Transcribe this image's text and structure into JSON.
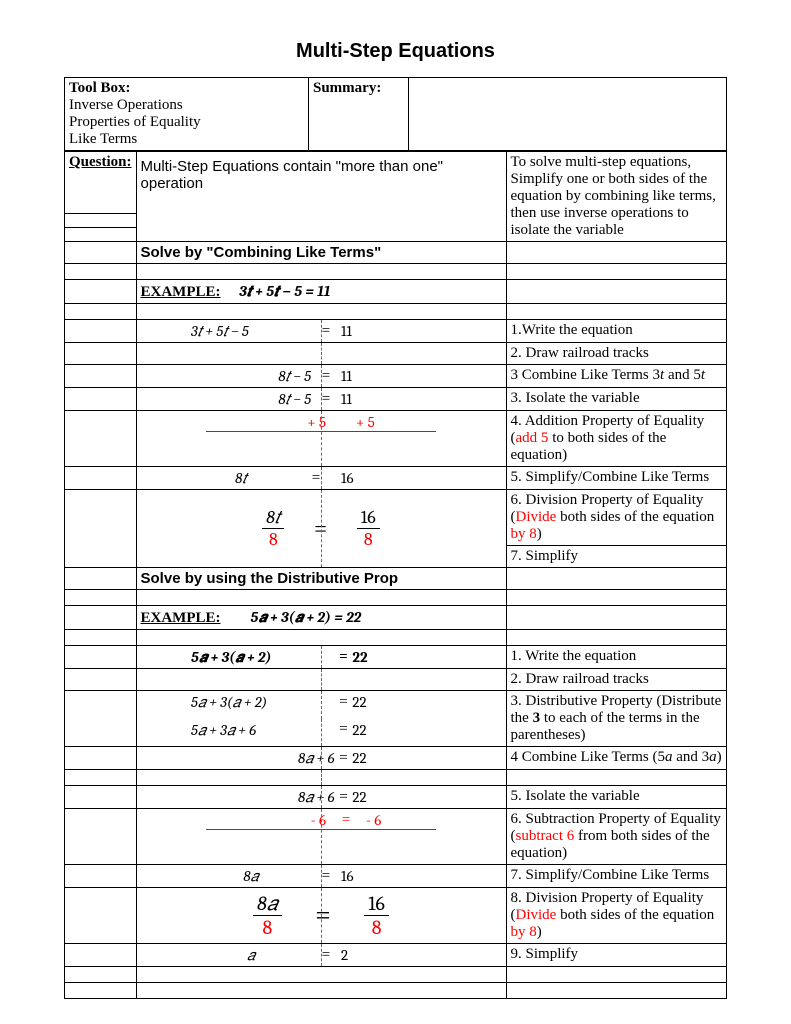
{
  "title": "Multi-Step Equations",
  "header": {
    "toolbox_label": "Tool Box:",
    "toolbox_item1": "Inverse Operations",
    "toolbox_item2": "Properties of Equality",
    "toolbox_item3": "Like Terms",
    "summary_label": "Summary:",
    "question_label": "Question:"
  },
  "intro": {
    "left": "Multi-Step Equations contain \"more than one\" operation",
    "right": "To solve multi-step equations, Simplify one or both sides of the equation by combining like terms, then use inverse operations to  isolate the variable"
  },
  "s1": {
    "head": "Solve by \"Combining Like Terms\"",
    "example_label": "EXAMPLE:",
    "example_eq": "3𝒕 +   5𝒕   −  5     =   11",
    "eq1_l": "3𝑡   +   5𝑡   −  5",
    "eq1_r": "11",
    "eq2_l": "8𝑡        − 5",
    "eq2_r": "11",
    "eq3_l": "8𝑡        − 5",
    "eq3_r": "11",
    "eq4_l": "+ 5",
    "eq4_r": "+ 5",
    "eq5_l": "8𝑡",
    "eq5_r": "16",
    "frac1_top_l": "8𝑡",
    "frac1_bot_l": "8",
    "frac1_top_r": "16",
    "frac1_bot_r": "8",
    "step1": "1.Write the equation",
    "step2": "2. Draw railroad tracks",
    "step3a": "3 Combine Like Terms 3",
    "step3b": "t",
    "step3c": " and 5",
    "step3d": "t",
    "step4": "3. Isolate the variable",
    "step5a": "4. Addition Property of Equality (",
    "step5b": "add 5",
    "step5c": " to both sides of the equation)",
    "step6": "5. Simplify/Combine Like Terms",
    "step7a": "6. Division Property of Equality (",
    "step7b": "Divide",
    "step7c": " both sides of the equation ",
    "step7d": "by 8",
    "step7e": ")",
    "step8": "7. Simplify"
  },
  "s2": {
    "head": "Solve by using the Distributive Prop",
    "example_label": "EXAMPLE:",
    "example_eq": "5𝒂    +  3(𝒂  +   2)   =    22",
    "eq1_l": "5𝒂     +  3(𝒂  +   2)",
    "eq1_r": "22",
    "eq2_l": "5𝑎     +  3(𝑎  +   2)",
    "eq2_r": "22",
    "eq3_l": "5𝑎    +      3𝑎  +   6",
    "eq3_r": "22",
    "eq4_l": "8𝑎         +   6",
    "eq4_r": "22",
    "eq5_l": "8𝑎         +   6",
    "eq5_r": "22",
    "eq6_l": "-   6",
    "eq6_r": "-  6",
    "eq7_l": "8𝑎",
    "eq7_r": "16",
    "frac2_top_l": "8𝑎",
    "frac2_bot_l": "8",
    "frac2_top_r": "16",
    "frac2_bot_r": "8",
    "eq9_l": "𝑎",
    "eq9_r": "2",
    "step1": "1. Write the equation",
    "step2": "2. Draw railroad tracks",
    "step3a": "3. Distributive Property (Distribute the ",
    "step3b": "3",
    "step3c": " to each of the terms in the parentheses)",
    "step4a": "4 Combine Like Terms (5",
    "step4b": "a",
    "step4c": " and 3",
    "step4d": "a",
    "step4e": ")",
    "step5": "5. Isolate the variable",
    "step6a": "6. Subtraction Property of Equality (",
    "step6b": "subtract 6",
    "step6c": " from both sides of the equation)",
    "step7": "7. Simplify/Combine Like Terms",
    "step8a": "8. Division Property of Equality (",
    "step8b": "Divide",
    "step8c": " both sides of the equation ",
    "step8d": "by 8",
    "step8e": ")",
    "step9": "9. Simplify"
  }
}
